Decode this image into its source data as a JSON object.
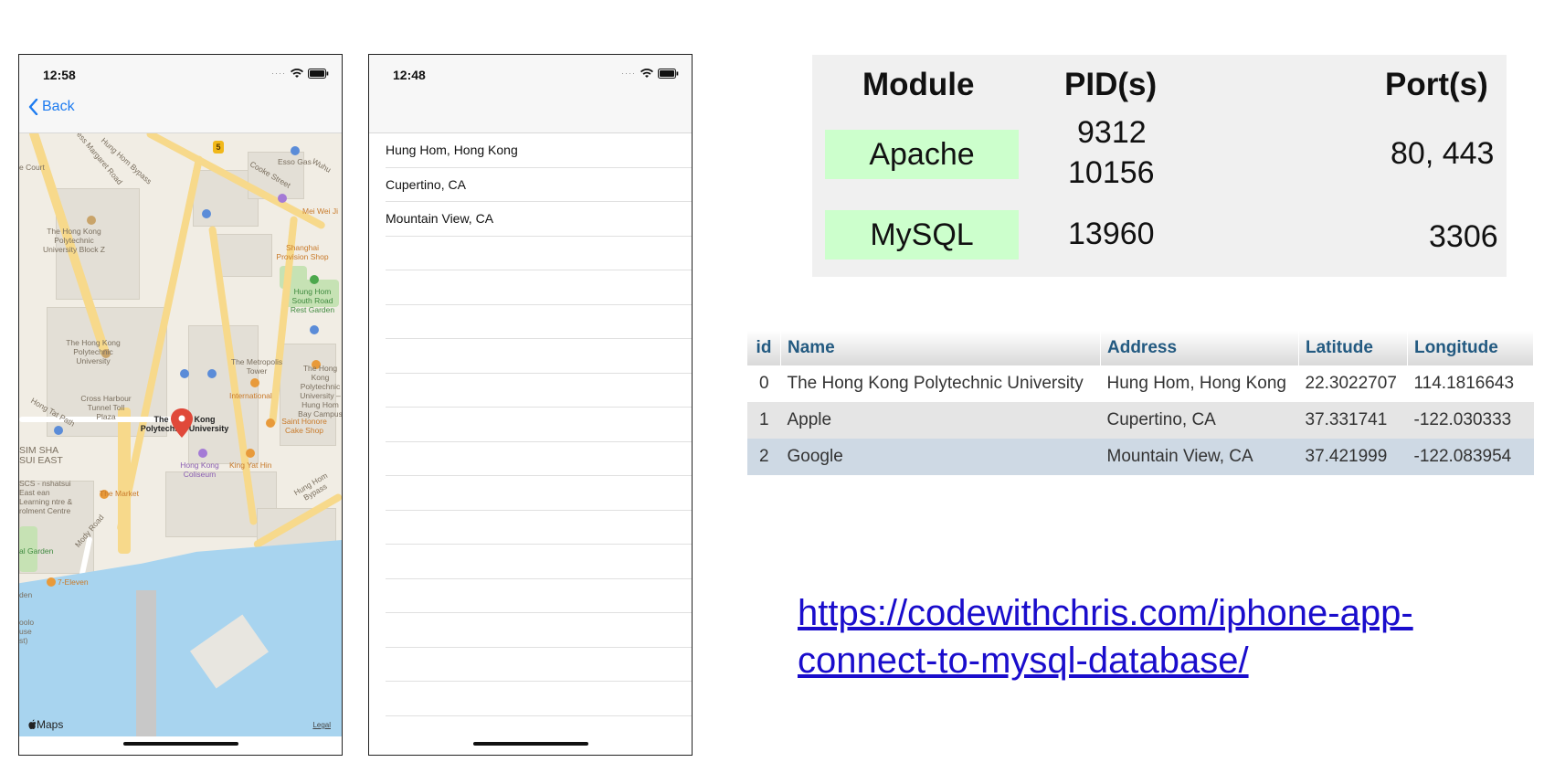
{
  "phone_map": {
    "time": "12:58",
    "back_label": "Back",
    "map_labels": {
      "court": "e Court",
      "hung_hom_bypass_top": "Hung Hom Bypass",
      "princess_margaret": "ess Margaret Road",
      "esso": "Esso Gas",
      "cooke_street": "Cooke Street",
      "mei_wei": "Mei Wei Ji",
      "wuhu": "Wuhu",
      "polyu_block_z": "The Hong Kong Polytechnic University Block Z",
      "shanghai_shop": "Shanghai Provision Shop",
      "hung_hom_south": "Hung Hom South Road Rest Garden",
      "polyu": "The Hong Kong Polytechnic University",
      "metropolis": "The Metropolis Tower",
      "international": "International",
      "polyu_campus": "The Hong Kong Polytechnic University – Hung Hom Bay Campus",
      "cross_harbour": "Cross Harbour Tunnel Toll Plaza",
      "hong_tat_path": "Hong Tat Path",
      "pin_label": "The Hong Kong Polytechnic University",
      "saint_honore": "Saint Honore Cake Shop",
      "sim_sha": "SIM SHA SUI EAST",
      "coliseum": "Hong Kong Coliseum",
      "king_yat_hin": "King Yat Hin",
      "scs": "SCS - nshatsui East ean Learning ntre & rolment Centre",
      "the_market": "The Market",
      "hung_hom_bypass_bottom": "Hung Hom Bypass",
      "mody_road": "Mody Road",
      "garden": "al Garden",
      "seven_eleven": "7-Eleven",
      "den": "den",
      "museum": "oolo use st)",
      "route_badge": "5"
    },
    "maps_logo": "Maps",
    "legal": "Legal"
  },
  "phone_list": {
    "time": "12:48",
    "rows": [
      "Hung Hom, Hong Kong",
      "Cupertino, CA",
      "Mountain View, CA",
      "",
      "",
      "",
      "",
      "",
      "",
      "",
      "",
      "",
      "",
      "",
      "",
      "",
      ""
    ]
  },
  "xampp": {
    "headers": {
      "module": "Module",
      "pids": "PID(s)",
      "ports": "Port(s)"
    },
    "modules": [
      {
        "name": "Apache",
        "pid_line1": "9312",
        "pid_line2": "10156",
        "ports": "80, 443"
      },
      {
        "name": "MySQL",
        "pid_line1": "13960",
        "pid_line2": "",
        "ports": "3306"
      }
    ]
  },
  "db_table": {
    "headers": [
      "id",
      "Name",
      "Address",
      "Latitude",
      "Longitude"
    ],
    "rows": [
      [
        "0",
        "The Hong Kong Polytechnic University",
        "Hung Hom, Hong Kong",
        "22.3022707",
        "114.1816643"
      ],
      [
        "1",
        "Apple",
        "Cupertino, CA",
        "37.331741",
        "-122.030333"
      ],
      [
        "2",
        "Google",
        "Mountain View, CA",
        "37.421999",
        "-122.083954"
      ]
    ]
  },
  "link": {
    "line1": "https://codewithchris.com/iphone-app-",
    "line2": "connect-to-mysql-database/"
  },
  "colors": {
    "ios_blue": "#1d7bf0",
    "pin_red": "#e0493a",
    "module_green": "#ccffcc",
    "db_header_text": "#235a81",
    "link": "#1a0dcc"
  }
}
